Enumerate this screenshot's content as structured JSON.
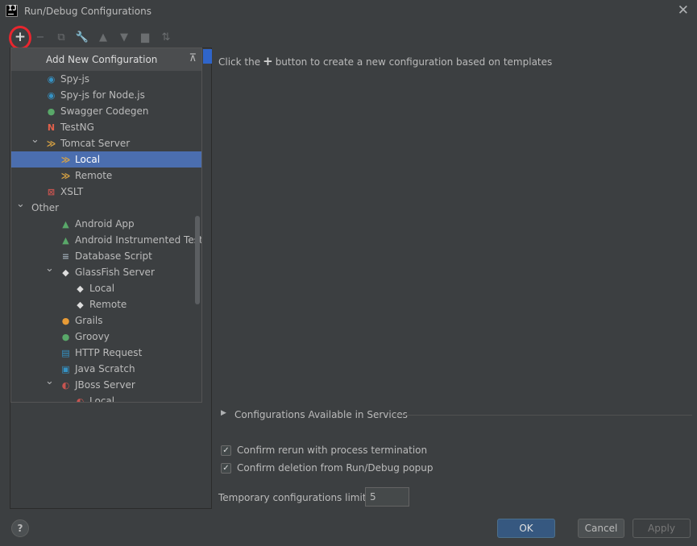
{
  "window": {
    "title": "Run/Debug Configurations",
    "logo_text": "IJ"
  },
  "toolbar": {
    "add_icon": "plus-icon",
    "items": [
      "minus-icon",
      "copy-icon",
      "wrench-icon",
      "arrow-up-icon",
      "arrow-down-icon",
      "folder-plus-icon",
      "sort-icon"
    ]
  },
  "popup": {
    "title": "Add New Configuration",
    "collapse_icon": "collapse-all-icon",
    "items": [
      {
        "label": "Spy-js",
        "icon": "spy-js-icon",
        "level": 1,
        "expand": "",
        "color": "#3592c4"
      },
      {
        "label": "Spy-js for Node.js",
        "icon": "spy-js-node-icon",
        "level": 1,
        "expand": "",
        "color": "#3592c4"
      },
      {
        "label": "Swagger Codegen",
        "icon": "swagger-icon",
        "level": 1,
        "expand": "",
        "color": "#59a869"
      },
      {
        "label": "TestNG",
        "icon": "testng-icon",
        "level": 1,
        "expand": "",
        "color": "#e0604b"
      },
      {
        "label": "Tomcat Server",
        "icon": "tomcat-icon",
        "level": 1,
        "expand": "expanded",
        "color": "#d9a343"
      },
      {
        "label": "Local",
        "icon": "tomcat-icon",
        "level": 2,
        "expand": "",
        "color": "#d9a343",
        "selected": true
      },
      {
        "label": "Remote",
        "icon": "tomcat-icon",
        "level": 2,
        "expand": "",
        "color": "#d9a343"
      },
      {
        "label": "XSLT",
        "icon": "xslt-icon",
        "level": 1,
        "expand": "",
        "color": "#c75450"
      },
      {
        "label": "Other",
        "icon": "",
        "level": 0,
        "expand": "expanded",
        "color": ""
      },
      {
        "label": "Android App",
        "icon": "android-icon",
        "level": 2,
        "expand": "",
        "color": "#59a869"
      },
      {
        "label": "Android Instrumented Tests",
        "icon": "android-test-icon",
        "level": 2,
        "expand": "",
        "color": "#59a869"
      },
      {
        "label": "Database Script",
        "icon": "database-icon",
        "level": 2,
        "expand": "",
        "color": "#9aa7b0"
      },
      {
        "label": "GlassFish Server",
        "icon": "glassfish-icon",
        "level": 2,
        "expand": "expanded",
        "color": "#dddddd"
      },
      {
        "label": "Local",
        "icon": "glassfish-icon",
        "level": 3,
        "expand": "",
        "color": "#dddddd"
      },
      {
        "label": "Remote",
        "icon": "glassfish-icon",
        "level": 3,
        "expand": "",
        "color": "#dddddd"
      },
      {
        "label": "Grails",
        "icon": "grails-icon",
        "level": 2,
        "expand": "",
        "color": "#e89b36"
      },
      {
        "label": "Groovy",
        "icon": "groovy-icon",
        "level": 2,
        "expand": "",
        "color": "#59a869"
      },
      {
        "label": "HTTP Request",
        "icon": "http-api-icon",
        "level": 2,
        "expand": "",
        "color": "#3592c4"
      },
      {
        "label": "Java Scratch",
        "icon": "java-scratch-icon",
        "level": 2,
        "expand": "",
        "color": "#3592c4"
      },
      {
        "label": "JBoss Server",
        "icon": "jboss-icon",
        "level": 2,
        "expand": "expanded",
        "color": "#c75450"
      },
      {
        "label": "Local",
        "icon": "jboss-icon",
        "level": 3,
        "expand": "",
        "color": "#c75450"
      }
    ]
  },
  "main": {
    "hint_before": "Click the",
    "hint_after": "button to create a new configuration based on templates",
    "services_label": "Configurations Available in Services",
    "confirm_rerun": "Confirm rerun with process termination",
    "confirm_deletion": "Confirm deletion from Run/Debug popup",
    "limit_label": "Temporary configurations limit:",
    "limit_value": "5"
  },
  "buttons": {
    "help": "?",
    "ok": "OK",
    "cancel": "Cancel",
    "apply": "Apply"
  }
}
